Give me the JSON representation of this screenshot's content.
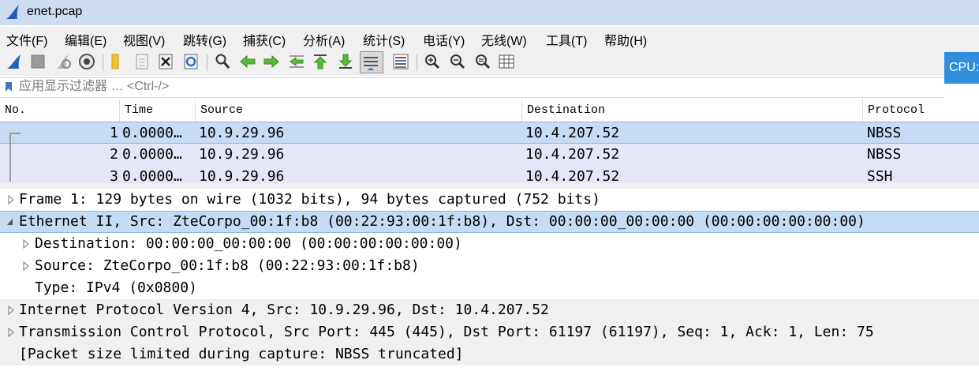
{
  "window": {
    "title": "enet.pcap"
  },
  "menu": [
    {
      "label": "文件(F)"
    },
    {
      "label": "编辑(E)"
    },
    {
      "label": "视图(V)"
    },
    {
      "label": "跳转(G)"
    },
    {
      "label": "捕获(C)"
    },
    {
      "label": "分析(A)"
    },
    {
      "label": "统计(S)"
    },
    {
      "label": "电话(Y)"
    },
    {
      "label": "无线(W)"
    },
    {
      "label": "工具(T)"
    },
    {
      "label": "帮助(H)"
    }
  ],
  "toolbar": {
    "icons": [
      "shark-fin-start-icon",
      "stop-icon",
      "restart-icon",
      "capture-options-icon",
      "open-folder-icon",
      "file-icon",
      "close-file-icon",
      "reload-icon",
      "find-icon",
      "go-back-icon",
      "go-forward-icon",
      "go-to-packet-icon",
      "go-first-icon",
      "go-last-icon",
      "autoscroll-icon",
      "colorize-icon",
      "zoom-in-icon",
      "zoom-out-icon",
      "zoom-normal-icon",
      "resize-columns-icon"
    ]
  },
  "cpu_tab": "CPU:",
  "filter": {
    "placeholder": "应用显示过滤器 … <Ctrl-/>"
  },
  "packet_list": {
    "columns": [
      "No.",
      "Time",
      "Source",
      "Destination",
      "Protocol"
    ],
    "rows": [
      {
        "no": "1",
        "time": "0.0000…",
        "source": "10.9.29.96",
        "destination": "10.4.207.52",
        "protocol": "NBSS"
      },
      {
        "no": "2",
        "time": "0.0000…",
        "source": "10.9.29.96",
        "destination": "10.4.207.52",
        "protocol": "NBSS"
      },
      {
        "no": "3",
        "time": "0.0000…",
        "source": "10.9.29.96",
        "destination": "10.4.207.52",
        "protocol": "SSH"
      }
    ]
  },
  "details": [
    {
      "text": "Frame 1: 129 bytes on wire (1032 bits), 94 bytes captured (752 bits)"
    },
    {
      "text": "Ethernet II, Src: ZteCorpo_00:1f:b8 (00:22:93:00:1f:b8), Dst: 00:00:00_00:00:00 (00:00:00:00:00:00)"
    },
    {
      "text": "Destination: 00:00:00_00:00:00 (00:00:00:00:00:00)"
    },
    {
      "text": "Source: ZteCorpo_00:1f:b8 (00:22:93:00:1f:b8)"
    },
    {
      "text": "Type: IPv4 (0x0800)"
    },
    {
      "text": "Internet Protocol Version 4, Src: 10.9.29.96, Dst: 10.4.207.52"
    },
    {
      "text": "Transmission Control Protocol, Src Port: 445 (445), Dst Port: 61197 (61197), Seq: 1, Ack: 1, Len: 75"
    },
    {
      "text": "[Packet size limited during capture: NBSS truncated]"
    }
  ]
}
